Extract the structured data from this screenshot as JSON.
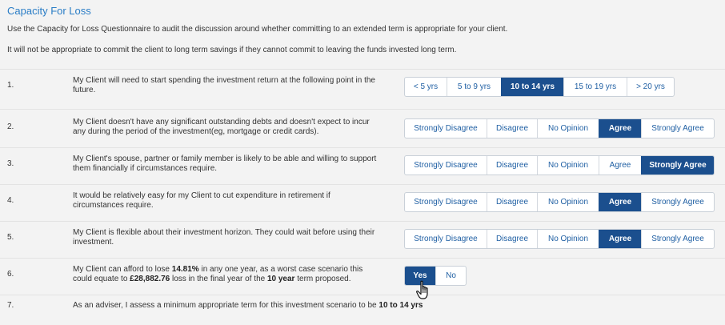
{
  "title": "Capacity For Loss",
  "intro": [
    "Use the Capacity for Loss Questionnaire to audit the discussion around whether committing to an extended term is appropriate for your client.",
    "It will not be appropriate to commit the client to long term savings if they cannot commit to leaving the funds invested long term."
  ],
  "questions": [
    {
      "num": "1.",
      "text": "My Client will need to start spending the investment return at the following point in the future.",
      "options": [
        "< 5 yrs",
        "5 to 9 yrs",
        "10 to 14 yrs",
        "15 to 19 yrs",
        "> 20 yrs"
      ],
      "selected": "10 to 14 yrs"
    },
    {
      "num": "2.",
      "text": "My Client doesn't have any significant outstanding debts and doesn't expect to incur any during the period of the investment(eg, mortgage or credit cards).",
      "options": [
        "Strongly Disagree",
        "Disagree",
        "No Opinion",
        "Agree",
        "Strongly Agree"
      ],
      "selected": "Agree"
    },
    {
      "num": "3.",
      "text": "My Client's spouse, partner or family member is likely to be able and willing to support them financially if circumstances require.",
      "options": [
        "Strongly Disagree",
        "Disagree",
        "No Opinion",
        "Agree",
        "Strongly Agree"
      ],
      "selected": "Strongly Agree"
    },
    {
      "num": "4.",
      "text": "It would be relatively easy for my Client to cut expenditure in retirement if circumstances require.",
      "options": [
        "Strongly Disagree",
        "Disagree",
        "No Opinion",
        "Agree",
        "Strongly Agree"
      ],
      "selected": "Agree"
    },
    {
      "num": "5.",
      "text": "My Client is flexible about their investment horizon. They could wait before using their investment.",
      "options": [
        "Strongly Disagree",
        "Disagree",
        "No Opinion",
        "Agree",
        "Strongly Agree"
      ],
      "selected": "Agree"
    },
    {
      "num": "6.",
      "text_parts": [
        "My Client can afford to lose ",
        "14.81%",
        " in any one year, as a worst case scenario this could equate to ",
        "£28,882.76",
        " loss in the final year of the ",
        "10 year",
        " term proposed."
      ],
      "options": [
        "Yes",
        "No"
      ],
      "selected": "Yes"
    },
    {
      "num": "7.",
      "text_parts": [
        "As an adviser, I assess a minimum appropriate term for this investment scenario to be ",
        "10 to 14 yrs"
      ]
    }
  ],
  "icons": {
    "cursor": "hand-pointer-icon"
  }
}
